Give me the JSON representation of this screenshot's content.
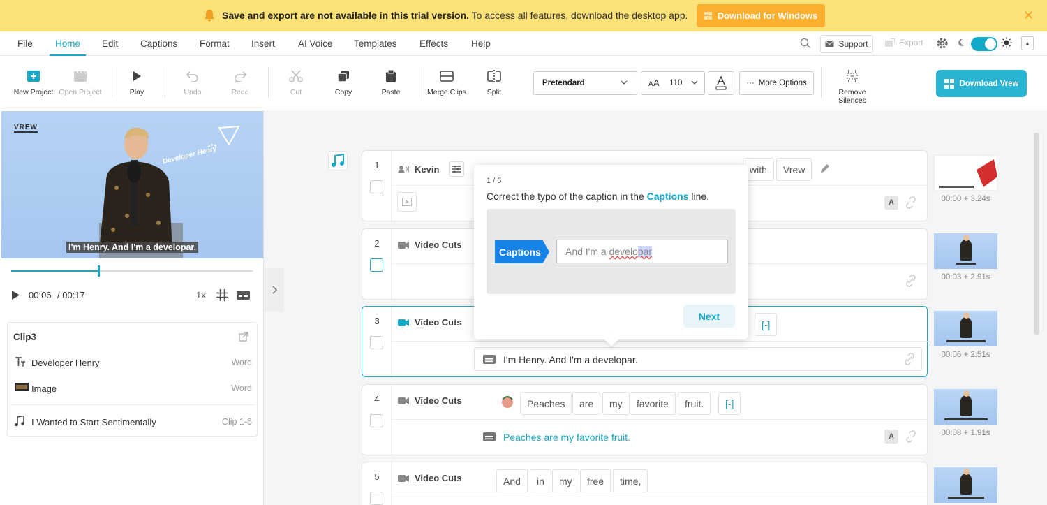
{
  "banner": {
    "bold_text": "Save and export are not available in this trial version.",
    "text": " To access all features, download the desktop app.",
    "button_label": "Download for Windows",
    "close_symbol": "✕"
  },
  "menu": {
    "items": [
      "File",
      "Home",
      "Edit",
      "Captions",
      "Format",
      "Insert",
      "AI Voice",
      "Templates",
      "Effects",
      "Help"
    ],
    "support_label": "Support",
    "export_label": "Export"
  },
  "toolbar": {
    "new_project": "New Project",
    "open_project": "Open Project",
    "play": "Play",
    "undo": "Undo",
    "redo": "Redo",
    "cut": "Cut",
    "copy": "Copy",
    "paste": "Paste",
    "merge_clips": "Merge Clips",
    "split": "Split",
    "font_name": "Pretendard",
    "font_size": "110",
    "more_options": "More Options",
    "remove_silences": "Remove Silences",
    "download_vrew": "Download Vrew"
  },
  "player": {
    "logo": "VREW",
    "video_tag": "Developer Henry",
    "caption": "I'm Henry. And I'm a developar.",
    "current_time": "00:06",
    "total_time": "/ 00:17",
    "speed": "1x",
    "progress_fraction": 0.367
  },
  "clip_panel": {
    "title": "Clip3",
    "rows": [
      {
        "label": "Developer Henry",
        "tag": "Word"
      },
      {
        "label": "Image",
        "tag": "Word"
      },
      {
        "label": "I Wanted to Start Sentimentally",
        "tag": "Clip 1-6"
      }
    ]
  },
  "clips": [
    {
      "num": "1",
      "speaker": "Kevin",
      "words": [
        "with",
        "Vrew"
      ],
      "thumb_time": "00:00 + 3.24s"
    },
    {
      "num": "2",
      "speaker": "Video Cuts",
      "thumb_time": "00:03 + 2.91s"
    },
    {
      "num": "3",
      "speaker": "Video Cuts",
      "words": [
        "[-]"
      ],
      "caption": "I'm Henry. And I'm a developar.",
      "thumb_time": "00:06 + 2.51s"
    },
    {
      "num": "4",
      "speaker": "Video Cuts",
      "words": [
        "Peaches",
        "are",
        "my",
        "favorite",
        "fruit.",
        "[-]"
      ],
      "caption": "Peaches are my favorite fruit.",
      "thumb_time": "00:08 + 1.91s"
    },
    {
      "num": "5",
      "speaker": "Video Cuts",
      "words": [
        "And",
        "in",
        "my",
        "free",
        "time,"
      ]
    }
  ],
  "badge_a": "A",
  "popover": {
    "step": "1 / 5",
    "text_before": "Correct the typo of the caption in the ",
    "text_highlight": "Captions",
    "text_after": " line.",
    "tag_label": "Captions",
    "input_plain": "And I'm a ",
    "input_typo": "develo",
    "input_selected": "par",
    "next_label": "Next"
  },
  "colors": {
    "accent": "#13a9c8",
    "banner": "#fde179",
    "banner_button": "#fbaf2e",
    "download": "#29b4d4",
    "tag_blue": "#1782e8"
  }
}
